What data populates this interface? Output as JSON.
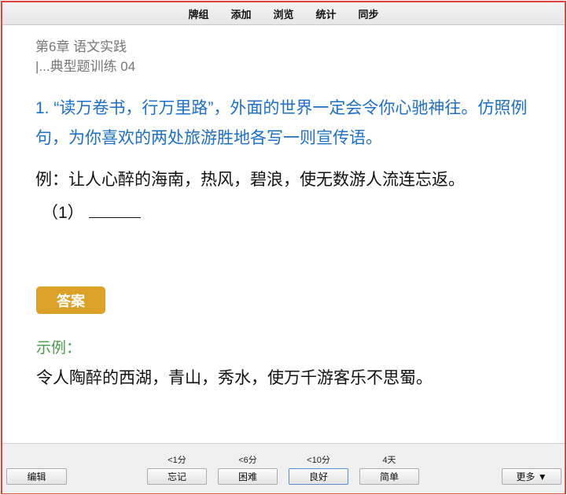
{
  "menu": [
    "牌组",
    "添加",
    "浏览",
    "统计",
    "同步"
  ],
  "card": {
    "chapter": "第6章 语文实践",
    "subchapter": "|...典型题训练 04",
    "question": "1. “读万卷书，行万里路”，外面的世界一定会令你心驰神往。仿照例句，为你喜欢的两处旅游胜地各写一则宣传语。",
    "example": "例：让人心醉的海南，热风，碧浪，使无数游人流连忘返。",
    "blank_prefix": "（1）",
    "answer_badge": "答案",
    "hint_label": "示例：",
    "answer": "令人陶醉的西湖，青山，秀水，使万千游客乐不思蜀。"
  },
  "toolbar": {
    "edit": "编辑",
    "more": "更多 ▼",
    "ease": [
      {
        "interval": "<1分",
        "label": "忘记"
      },
      {
        "interval": "<6分",
        "label": "困难"
      },
      {
        "interval": "<10分",
        "label": "良好"
      },
      {
        "interval": "4天",
        "label": "简单"
      }
    ]
  },
  "colors": {
    "border": "#e8413a",
    "question": "#1e6fc6",
    "badge": "#dca128",
    "hint": "#4a9a48"
  }
}
